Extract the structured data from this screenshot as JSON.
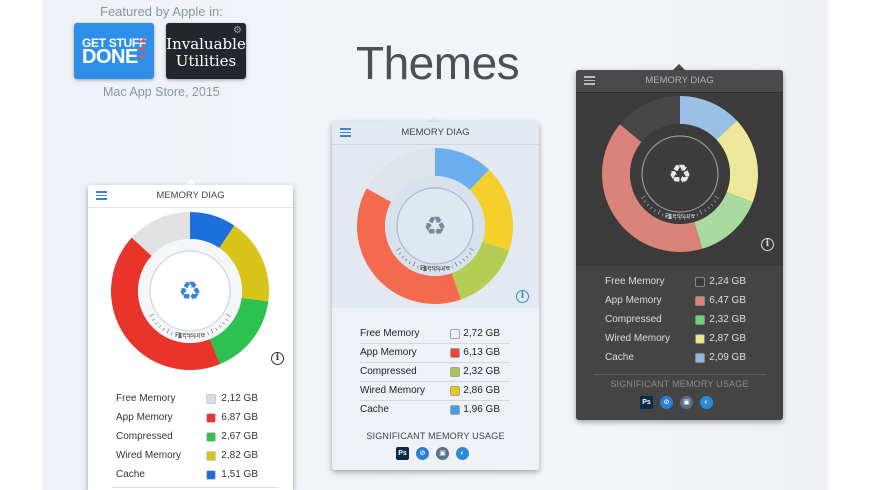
{
  "featured": {
    "title": "Featured by Apple in:",
    "subtitle": "Mac App Store, 2015",
    "badge_gsd_line1": "GET STUFF",
    "badge_gsd_line2": "DONE",
    "badge_inv_line1": "Invaluable",
    "badge_inv_line2": "Utilities"
  },
  "page_title": "Themes",
  "panels": [
    {
      "theme": "light",
      "title": "MEMORY DIAG",
      "pressure_label": "Pressure",
      "rows": [
        {
          "label": "Free Memory",
          "value": "2,12 GB",
          "color": "#dddddd"
        },
        {
          "label": "App Memory",
          "value": "6,87 GB",
          "color": "#e8342a"
        },
        {
          "label": "Compressed",
          "value": "2,67 GB",
          "color": "#2dc24f"
        },
        {
          "label": "Wired Memory",
          "value": "2,82 GB",
          "color": "#d9c51a"
        },
        {
          "label": "Cache",
          "value": "1,51 GB",
          "color": "#1d6fdc"
        }
      ],
      "segments": [
        {
          "name": "Cache",
          "fraction": 0.095,
          "color": "#1d6fdc"
        },
        {
          "name": "Wired Memory",
          "fraction": 0.176,
          "color": "#d9c51a"
        },
        {
          "name": "Compressed",
          "fraction": 0.167,
          "color": "#2dc24f"
        },
        {
          "name": "App Memory",
          "fraction": 0.43,
          "color": "#e8342a"
        },
        {
          "name": "Free Memory",
          "fraction": 0.132,
          "color": "#e2e2e2"
        }
      ]
    },
    {
      "theme": "gradient",
      "title": "MEMORY DIAG",
      "pressure_label": "Pressure",
      "rows": [
        {
          "label": "Free Memory",
          "value": "2,72 GB",
          "color": "#f2f2f2"
        },
        {
          "label": "App Memory",
          "value": "6,13 GB",
          "color": "#f2452f"
        },
        {
          "label": "Compressed",
          "value": "2,32 GB",
          "color": "#a7c64a"
        },
        {
          "label": "Wired Memory",
          "value": "2,86 GB",
          "color": "#f2c40d"
        },
        {
          "label": "Cache",
          "value": "1,96 GB",
          "color": "#4a9be8"
        }
      ],
      "segments": [
        {
          "name": "Cache",
          "fraction": 0.122,
          "color": "#6aaef0"
        },
        {
          "name": "Wired Memory",
          "fraction": 0.179,
          "color": "#f5d02a"
        },
        {
          "name": "Compressed",
          "fraction": 0.145,
          "color": "#b5cd55"
        },
        {
          "name": "App Memory",
          "fraction": 0.384,
          "color": "#f36a4e"
        },
        {
          "name": "Free Memory",
          "fraction": 0.17,
          "color": "#dfe4ea"
        }
      ],
      "significant_label": "SIGNIFICANT MEMORY USAGE"
    },
    {
      "theme": "dark",
      "title": "MEMORY DIAG",
      "pressure_label": "Pressure",
      "rows": [
        {
          "label": "Free Memory",
          "value": "2,24 GB",
          "color": "#3a3a3a"
        },
        {
          "label": "App Memory",
          "value": "6,47 GB",
          "color": "#e0847a"
        },
        {
          "label": "Compressed",
          "value": "2,32 GB",
          "color": "#6fd17a"
        },
        {
          "label": "Wired Memory",
          "value": "2,87 GB",
          "color": "#eee68a"
        },
        {
          "label": "Cache",
          "value": "2,09 GB",
          "color": "#8fb7e0"
        }
      ],
      "segments": [
        {
          "name": "Cache",
          "fraction": 0.13,
          "color": "#9bc0e6"
        },
        {
          "name": "Wired Memory",
          "fraction": 0.179,
          "color": "#efe89a"
        },
        {
          "name": "Compressed",
          "fraction": 0.145,
          "color": "#a9dba0"
        },
        {
          "name": "App Memory",
          "fraction": 0.406,
          "color": "#d9837a"
        },
        {
          "name": "Free Memory",
          "fraction": 0.14,
          "color": "#474747"
        }
      ],
      "significant_label": "SIGNIFICANT MEMORY USAGE"
    }
  ],
  "app_icons": [
    {
      "name": "photoshop-icon",
      "glyph": "Ps",
      "color": "#0b2a4a"
    },
    {
      "name": "safari-icon",
      "glyph": "⊘",
      "color": "#2d7fd6"
    },
    {
      "name": "preview-icon",
      "glyph": "▣",
      "color": "#5a6f86"
    },
    {
      "name": "browser-icon",
      "glyph": "◐",
      "color": "#2b8ad6"
    }
  ]
}
